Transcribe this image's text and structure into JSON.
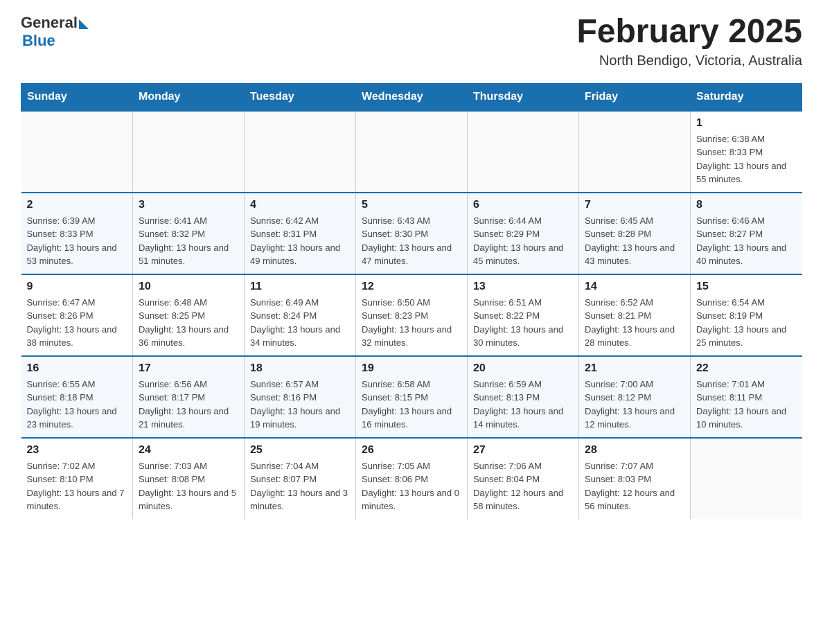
{
  "header": {
    "logo_general": "General",
    "logo_blue": "Blue",
    "month_title": "February 2025",
    "location": "North Bendigo, Victoria, Australia"
  },
  "weekdays": [
    "Sunday",
    "Monday",
    "Tuesday",
    "Wednesday",
    "Thursday",
    "Friday",
    "Saturday"
  ],
  "weeks": [
    {
      "days": [
        {
          "num": "",
          "info": ""
        },
        {
          "num": "",
          "info": ""
        },
        {
          "num": "",
          "info": ""
        },
        {
          "num": "",
          "info": ""
        },
        {
          "num": "",
          "info": ""
        },
        {
          "num": "",
          "info": ""
        },
        {
          "num": "1",
          "info": "Sunrise: 6:38 AM\nSunset: 8:33 PM\nDaylight: 13 hours and 55 minutes."
        }
      ]
    },
    {
      "days": [
        {
          "num": "2",
          "info": "Sunrise: 6:39 AM\nSunset: 8:33 PM\nDaylight: 13 hours and 53 minutes."
        },
        {
          "num": "3",
          "info": "Sunrise: 6:41 AM\nSunset: 8:32 PM\nDaylight: 13 hours and 51 minutes."
        },
        {
          "num": "4",
          "info": "Sunrise: 6:42 AM\nSunset: 8:31 PM\nDaylight: 13 hours and 49 minutes."
        },
        {
          "num": "5",
          "info": "Sunrise: 6:43 AM\nSunset: 8:30 PM\nDaylight: 13 hours and 47 minutes."
        },
        {
          "num": "6",
          "info": "Sunrise: 6:44 AM\nSunset: 8:29 PM\nDaylight: 13 hours and 45 minutes."
        },
        {
          "num": "7",
          "info": "Sunrise: 6:45 AM\nSunset: 8:28 PM\nDaylight: 13 hours and 43 minutes."
        },
        {
          "num": "8",
          "info": "Sunrise: 6:46 AM\nSunset: 8:27 PM\nDaylight: 13 hours and 40 minutes."
        }
      ]
    },
    {
      "days": [
        {
          "num": "9",
          "info": "Sunrise: 6:47 AM\nSunset: 8:26 PM\nDaylight: 13 hours and 38 minutes."
        },
        {
          "num": "10",
          "info": "Sunrise: 6:48 AM\nSunset: 8:25 PM\nDaylight: 13 hours and 36 minutes."
        },
        {
          "num": "11",
          "info": "Sunrise: 6:49 AM\nSunset: 8:24 PM\nDaylight: 13 hours and 34 minutes."
        },
        {
          "num": "12",
          "info": "Sunrise: 6:50 AM\nSunset: 8:23 PM\nDaylight: 13 hours and 32 minutes."
        },
        {
          "num": "13",
          "info": "Sunrise: 6:51 AM\nSunset: 8:22 PM\nDaylight: 13 hours and 30 minutes."
        },
        {
          "num": "14",
          "info": "Sunrise: 6:52 AM\nSunset: 8:21 PM\nDaylight: 13 hours and 28 minutes."
        },
        {
          "num": "15",
          "info": "Sunrise: 6:54 AM\nSunset: 8:19 PM\nDaylight: 13 hours and 25 minutes."
        }
      ]
    },
    {
      "days": [
        {
          "num": "16",
          "info": "Sunrise: 6:55 AM\nSunset: 8:18 PM\nDaylight: 13 hours and 23 minutes."
        },
        {
          "num": "17",
          "info": "Sunrise: 6:56 AM\nSunset: 8:17 PM\nDaylight: 13 hours and 21 minutes."
        },
        {
          "num": "18",
          "info": "Sunrise: 6:57 AM\nSunset: 8:16 PM\nDaylight: 13 hours and 19 minutes."
        },
        {
          "num": "19",
          "info": "Sunrise: 6:58 AM\nSunset: 8:15 PM\nDaylight: 13 hours and 16 minutes."
        },
        {
          "num": "20",
          "info": "Sunrise: 6:59 AM\nSunset: 8:13 PM\nDaylight: 13 hours and 14 minutes."
        },
        {
          "num": "21",
          "info": "Sunrise: 7:00 AM\nSunset: 8:12 PM\nDaylight: 13 hours and 12 minutes."
        },
        {
          "num": "22",
          "info": "Sunrise: 7:01 AM\nSunset: 8:11 PM\nDaylight: 13 hours and 10 minutes."
        }
      ]
    },
    {
      "days": [
        {
          "num": "23",
          "info": "Sunrise: 7:02 AM\nSunset: 8:10 PM\nDaylight: 13 hours and 7 minutes."
        },
        {
          "num": "24",
          "info": "Sunrise: 7:03 AM\nSunset: 8:08 PM\nDaylight: 13 hours and 5 minutes."
        },
        {
          "num": "25",
          "info": "Sunrise: 7:04 AM\nSunset: 8:07 PM\nDaylight: 13 hours and 3 minutes."
        },
        {
          "num": "26",
          "info": "Sunrise: 7:05 AM\nSunset: 8:06 PM\nDaylight: 13 hours and 0 minutes."
        },
        {
          "num": "27",
          "info": "Sunrise: 7:06 AM\nSunset: 8:04 PM\nDaylight: 12 hours and 58 minutes."
        },
        {
          "num": "28",
          "info": "Sunrise: 7:07 AM\nSunset: 8:03 PM\nDaylight: 12 hours and 56 minutes."
        },
        {
          "num": "",
          "info": ""
        }
      ]
    }
  ]
}
